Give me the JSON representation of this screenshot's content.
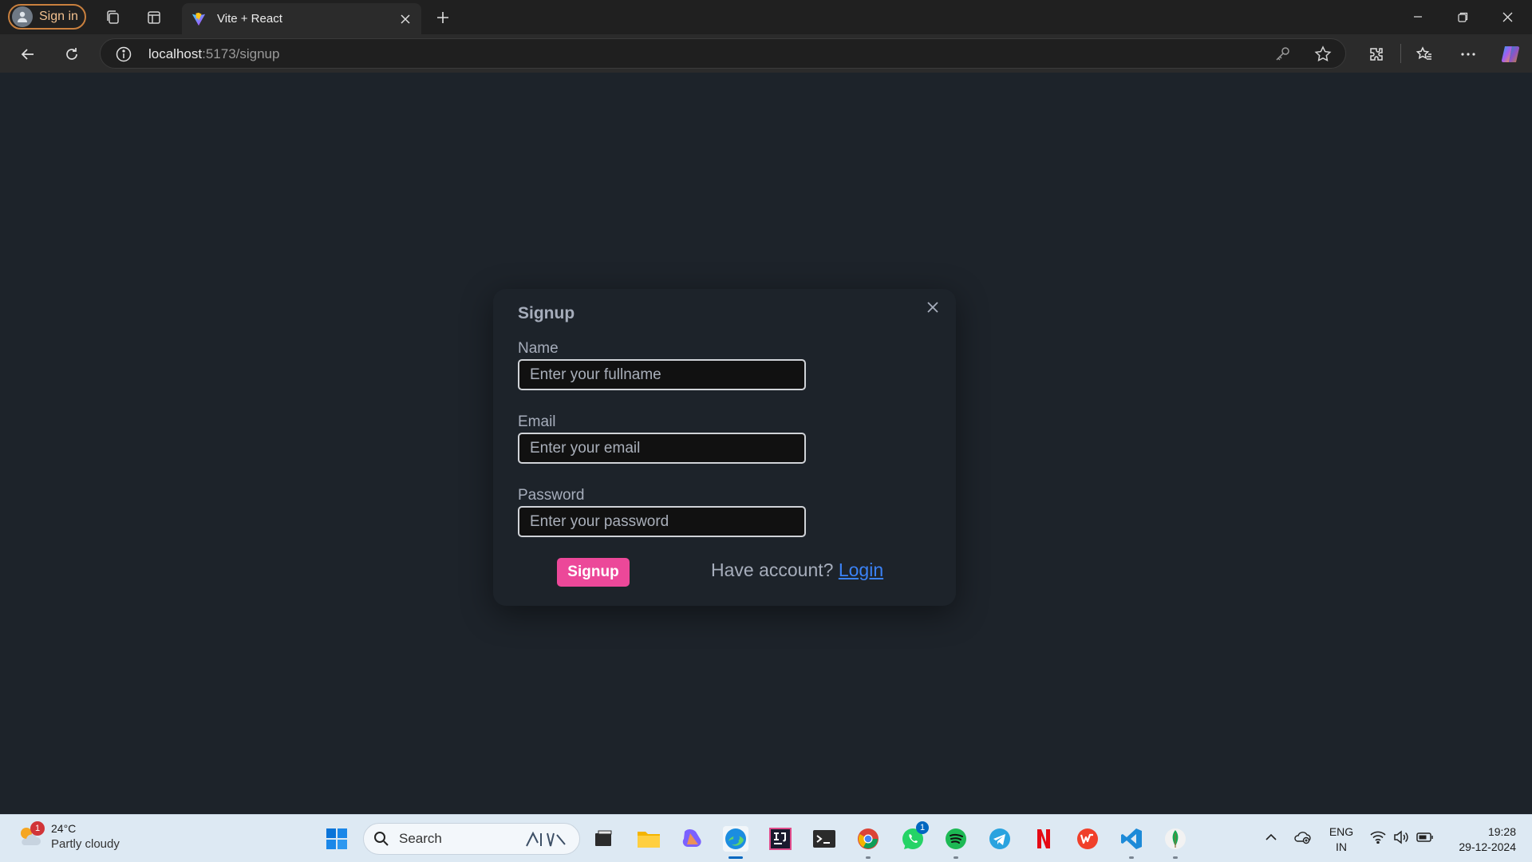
{
  "browser": {
    "profile_label": "Sign in",
    "tab_title": "Vite + React",
    "url_host": "localhost",
    "url_path": ":5173/signup"
  },
  "modal": {
    "title": "Signup",
    "fields": [
      {
        "label": "Name",
        "placeholder": "Enter your fullname"
      },
      {
        "label": "Email",
        "placeholder": "Enter your email"
      },
      {
        "label": "Password",
        "placeholder": "Enter your password"
      }
    ],
    "submit_label": "Signup",
    "have_account_text": "Have account?",
    "login_link": "Login"
  },
  "taskbar": {
    "weather_temp": "24°C",
    "weather_desc": "Partly cloudy",
    "weather_badge": "1",
    "search_label": "Search",
    "whatsapp_badge": "1",
    "lang_line1": "ENG",
    "lang_line2": "IN",
    "time": "19:28",
    "date": "29-12-2024"
  },
  "colors": {
    "accent_pink": "#ec4899",
    "link_blue": "#3b82f6",
    "page_bg": "#1d232a"
  }
}
